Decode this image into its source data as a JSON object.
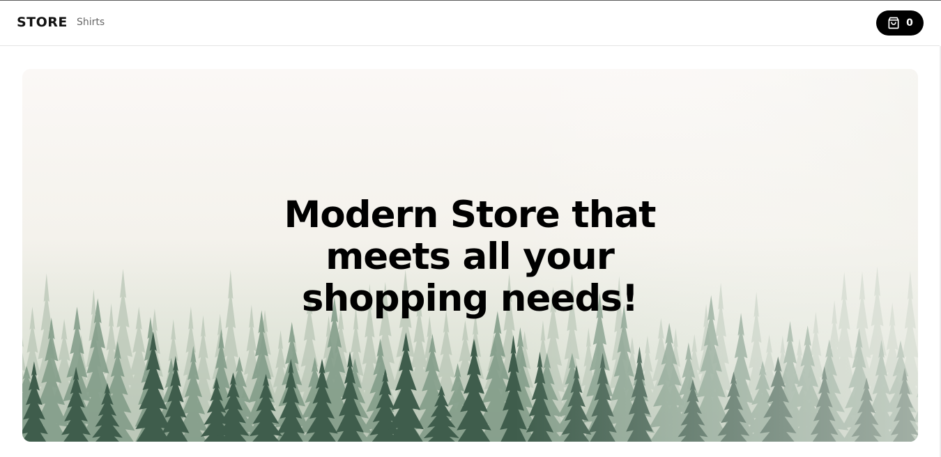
{
  "header": {
    "brand": "STORE",
    "nav_links": [
      {
        "label": "Shirts"
      }
    ],
    "cart": {
      "icon": "shopping-bag-icon",
      "count": "0"
    }
  },
  "hero": {
    "title": "Modern Store that meets all your shopping needs!",
    "background": "foggy-pine-forest"
  },
  "colors": {
    "text": "#000000",
    "nav_link": "#666666",
    "cart_button_bg": "#000000",
    "cart_button_text": "#ffffff",
    "forest_dark": "#2f4a3c",
    "forest_mid": "#57725f",
    "fog": "#f7f5f1"
  }
}
